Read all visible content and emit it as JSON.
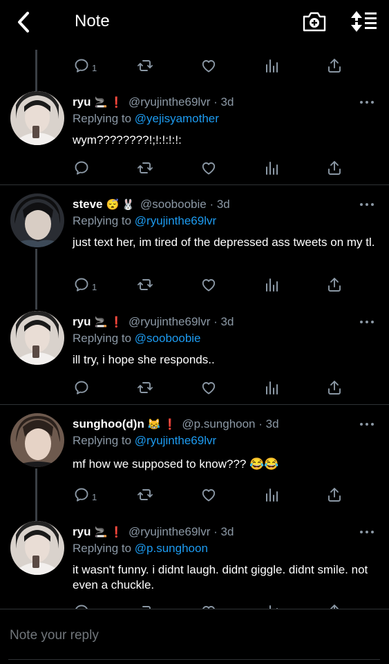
{
  "header": {
    "title": "Note",
    "back_icon": "chevron-left-icon",
    "camera_icon": "camera-plus-icon",
    "sort_icon": "sort-lines-icon"
  },
  "colors": {
    "background": "#000000",
    "text": "#ffffff",
    "secondary": "#8b98a5",
    "link": "#1d9bf0",
    "divider": "#2f3336"
  },
  "top_actions": {
    "reply_count": "1"
  },
  "tweets": [
    {
      "name": "ryu",
      "emojis": "🚬 ❗",
      "handle": "@ryujinthe69lvr",
      "time": "3d",
      "replying_prefix": "Replying to",
      "replying_to": "@yejisyamother",
      "text": "wym????????!;!:!:!:!:",
      "reply_count": ""
    },
    {
      "name": "steve",
      "emojis": "😴 🐰",
      "handle": "@sooboobie",
      "time": "3d",
      "replying_prefix": "Replying to",
      "replying_to": "@ryujinthe69lvr",
      "text": "just text her, im tired of the depressed ass tweets on my tl.",
      "reply_count": "1"
    },
    {
      "name": "ryu",
      "emojis": "🚬 ❗",
      "handle": "@ryujinthe69lvr",
      "time": "3d",
      "replying_prefix": "Replying to",
      "replying_to": "@sooboobie",
      "text": "ill try, i hope she responds..",
      "reply_count": ""
    },
    {
      "name": "sunghoo(d)n",
      "emojis": "😹 ❗",
      "handle": "@p.sunghoon",
      "time": "3d",
      "replying_prefix": "Replying to",
      "replying_to": "@ryujinthe69lvr",
      "text": "mf how we supposed to know??? 😂😂",
      "reply_count": "1"
    },
    {
      "name": "ryu",
      "emojis": "🚬 ❗",
      "handle": "@ryujinthe69lvr",
      "time": "3d",
      "replying_prefix": "Replying to",
      "replying_to": "@p.sunghoon",
      "text": "it wasn't funny. i didnt laugh. didnt giggle. didnt smile. not even a chuckle.",
      "reply_count": ""
    }
  ],
  "composer": {
    "placeholder": "Note your reply"
  }
}
